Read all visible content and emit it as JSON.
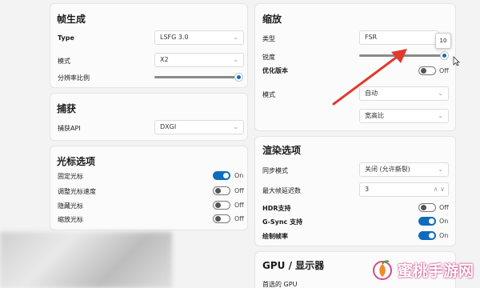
{
  "frame_gen": {
    "title": "帧生成",
    "type_label": "Type",
    "type_value": "LSFG 3.0",
    "mode_label": "模式",
    "mode_value": "X2",
    "resolution_label": "分辨率比例",
    "resolution_level": 1.0
  },
  "capture": {
    "title": "捕获",
    "api_label": "捕获API",
    "api_value": "DXGI"
  },
  "cursor": {
    "title": "光标选项",
    "items": [
      {
        "label": "固定光标",
        "state": "On",
        "on": true
      },
      {
        "label": "调整光标速度",
        "state": "Off",
        "on": false
      },
      {
        "label": "隐藏光标",
        "state": "Off",
        "on": false
      },
      {
        "label": "缩放光标",
        "state": "Off",
        "on": false
      }
    ]
  },
  "scaling": {
    "title": "缩放",
    "type_label": "类型",
    "type_value": "FSR",
    "sharpness_label": "锐度",
    "sharpness_tooltip": "10",
    "sharpness_level": 1.0,
    "optimize_label": "优化版本",
    "optimize_state": "Off",
    "mode_label": "模式",
    "mode_value": "自动",
    "aspect_value": "宽高比"
  },
  "render": {
    "title": "渲染选项",
    "sync_label": "同步模式",
    "sync_value": "关闭 (允许撕裂)",
    "latency_label": "最大帧延迟数",
    "latency_value": "3",
    "hdr_label": "HDR支持",
    "hdr_state": "Off",
    "gsync_label": "G-Sync 支持",
    "gsync_state": "On",
    "draw_label": "绘制帧率",
    "draw_state": "On"
  },
  "gpu": {
    "title": "GPU / 显示器",
    "preferred_label": "首选的 GPU"
  },
  "watermark": {
    "text": "蜜桃手游网"
  },
  "colors": {
    "accent": "#0f6cbd",
    "arrow": "#e03a2e"
  }
}
